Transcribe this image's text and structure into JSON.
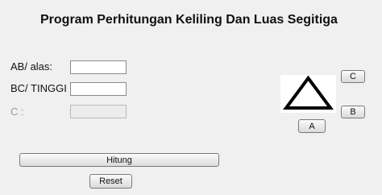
{
  "app": {
    "title": "Program Perhitungan Keliling Dan Luas Segitiga"
  },
  "form": {
    "ab_label": "AB/ alas:",
    "ab_value": "",
    "bc_label": "BC/ TINGGI :",
    "bc_value": "",
    "c_label": "C :",
    "c_value": ""
  },
  "buttons": {
    "hitung": "Hitung",
    "reset": "Reset",
    "side_a": "A",
    "side_b": "B",
    "side_c": "C"
  },
  "colors": {
    "window_bg": "#f0f0f0",
    "triangle_stroke": "#000000"
  },
  "icons": {
    "triangle": "triangle-outline"
  }
}
